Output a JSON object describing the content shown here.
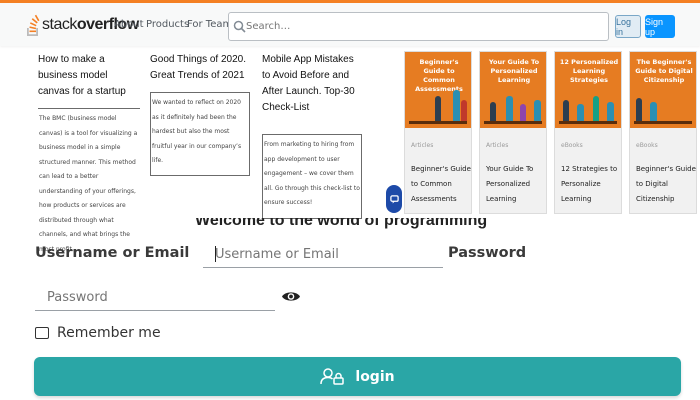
{
  "stackoverflow": {
    "logo_plain": "stack",
    "logo_bold": "overflow",
    "nav": [
      "About",
      "Products",
      "For Teams"
    ],
    "search_placeholder": "Search…",
    "login_label": "Log in",
    "signup_label": "Sign up",
    "accent_color": "#f48024",
    "signup_color": "#0a95ff"
  },
  "articles": [
    {
      "title": "How to make a business model canvas for a startup",
      "body": "The BMC (business model canvas) is a tool for visualizing a business model in a simple structured manner. This method can lead to a better understanding of your offerings, how products or services are distributed through what channels, and what brings the most profit."
    },
    {
      "title": "Good Things of 2020. Great Trends of 2021",
      "body": "We wanted to reflect on 2020 as it definitely had been the hardest but also the most fruitful year in our company’s life."
    },
    {
      "title": "Mobile App Mistakes to Avoid Before and After Launch. Top-30 Check-List",
      "body": "From marketing to hiring from app development to user engagement – we cover them all. Go through this check-list to ensure success!"
    }
  ],
  "cards": [
    {
      "image_title": "Beginner's Guide to Common Assessments",
      "type": "Articles",
      "title": "Beginner's Guide to Common Assessments"
    },
    {
      "image_title": "Your Guide To Personalized Learning",
      "type": "Articles",
      "title": "Your Guide To Personalized Learning"
    },
    {
      "image_title": "12 Personalized Learning Strategies",
      "type": "eBooks",
      "title": "12 Strategies to Personalize Learning"
    },
    {
      "image_title": "The Beginner's Guide to Digital Citizenship",
      "type": "eBooks",
      "title": "Beginner's Guide to Digital Citizenship"
    }
  ],
  "login_form": {
    "welcome": "Welcome to the world of programming",
    "username_label": "Username or Email",
    "username_placeholder": "Username or Email",
    "password_label": "Password",
    "password_placeholder": "Password",
    "remember_label": "Remember me",
    "submit_label": "login",
    "button_color": "#2aa6a6"
  },
  "icons": {
    "search": "search-icon",
    "chat": "chat-bubble-icon",
    "eye": "eye-icon",
    "user_lock": "user-lock-icon"
  }
}
